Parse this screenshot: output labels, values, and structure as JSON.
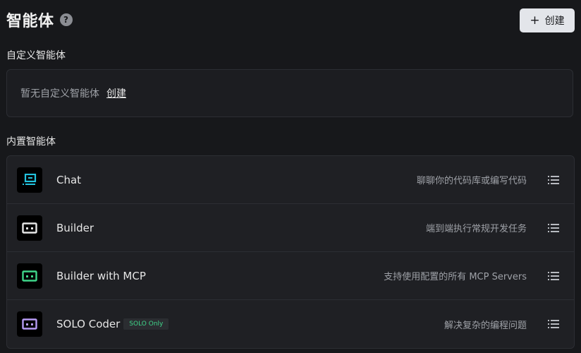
{
  "header": {
    "title": "智能体",
    "help_icon": "?",
    "create_button": {
      "icon": "+",
      "label": "创建"
    }
  },
  "custom_section": {
    "title": "自定义智能体",
    "empty_text": "暂无自定义智能体",
    "create_link": "创建"
  },
  "builtin_section": {
    "title": "内置智能体",
    "agents": [
      {
        "name": "Chat",
        "description": "聊聊你的代码库或编写代码",
        "icon_color": "#22c3de"
      },
      {
        "name": "Builder",
        "description": "端到端执行常规开发任务",
        "icon_color": "#e6e6e6"
      },
      {
        "name": "Builder with MCP",
        "description": "支持使用配置的所有 MCP Servers",
        "icon_color": "#3fd68a"
      },
      {
        "name": "SOLO Coder",
        "badge": "SOLO Only",
        "description": "解决复杂的编程问题",
        "icon_color": "#b79cf5"
      }
    ]
  }
}
